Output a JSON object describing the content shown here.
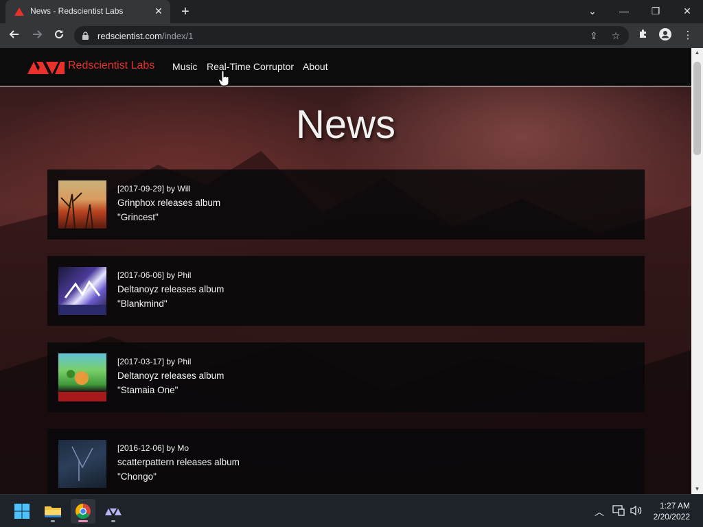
{
  "browser": {
    "tab_title": "News - Redscientist Labs",
    "tab_close": "✕",
    "new_tab": "+",
    "url_domain": "redscientist.com",
    "url_path": "/index/1",
    "window_controls": {
      "dropdown": "⌄",
      "minimize": "—",
      "restore": "❐",
      "close": "✕"
    }
  },
  "site": {
    "brand": "Redscientist Labs",
    "nav": [
      "Music",
      "Real-Time Corruptor",
      "About"
    ],
    "heading": "News"
  },
  "news": [
    {
      "meta": "[2017-09-29] by Will",
      "line1": "Grinphox releases album",
      "line2": "\"Grincest\""
    },
    {
      "meta": "[2017-06-06] by Phil",
      "line1": "Deltanoyz releases album",
      "line2": "\"Blankmind\""
    },
    {
      "meta": "[2017-03-17] by Phil",
      "line1": "Deltanoyz releases album",
      "line2": "\"Stamaia One\""
    },
    {
      "meta": "[2016-12-06] by Mo",
      "line1": "scatterpattern releases album",
      "line2": "\"Chongo\""
    }
  ],
  "taskbar": {
    "time": "1:27 AM",
    "date": "2/20/2022"
  },
  "colors": {
    "brand_red": "#e8312a",
    "page_bg": "#3e1d1e",
    "card_bg": "#080809"
  }
}
